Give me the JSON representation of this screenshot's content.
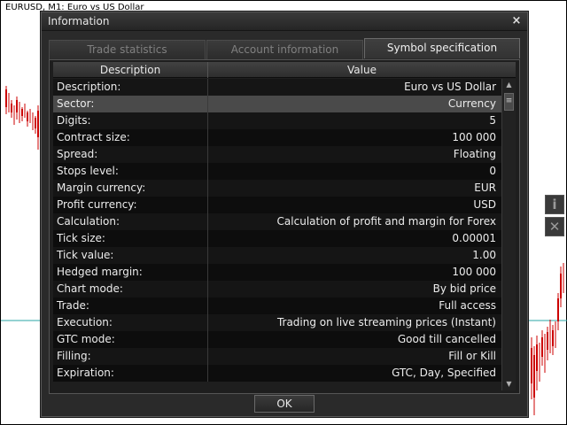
{
  "chart": {
    "title": "EURUSD, M1:  Euro vs US Dollar"
  },
  "side_buttons": {
    "info_glyph": "i",
    "close_glyph": "✕"
  },
  "dialog": {
    "title": "Information",
    "close_glyph": "×",
    "tabs": [
      {
        "label": "Trade statistics",
        "active": false
      },
      {
        "label": "Account information",
        "active": false
      },
      {
        "label": "Symbol specification",
        "active": true
      }
    ],
    "table": {
      "columns": [
        "Description",
        "Value"
      ],
      "rows": [
        {
          "description": "Description:",
          "value": "Euro vs US Dollar"
        },
        {
          "description": "Sector:",
          "value": "Currency",
          "selected": true
        },
        {
          "description": "Digits:",
          "value": "5"
        },
        {
          "description": "Contract size:",
          "value": "100 000"
        },
        {
          "description": "Spread:",
          "value": "Floating"
        },
        {
          "description": "Stops level:",
          "value": "0"
        },
        {
          "description": "Margin currency:",
          "value": "EUR"
        },
        {
          "description": "Profit currency:",
          "value": "USD"
        },
        {
          "description": "Calculation:",
          "value": "Calculation of profit and margin for Forex"
        },
        {
          "description": "Tick size:",
          "value": "0.00001"
        },
        {
          "description": "Tick value:",
          "value": "1.00"
        },
        {
          "description": "Hedged margin:",
          "value": "100 000"
        },
        {
          "description": "Chart mode:",
          "value": "By bid price"
        },
        {
          "description": "Trade:",
          "value": "Full access"
        },
        {
          "description": "Execution:",
          "value": "Trading on live streaming prices (Instant)"
        },
        {
          "description": "GTC mode:",
          "value": "Good till cancelled"
        },
        {
          "description": "Filling:",
          "value": "Fill or Kill"
        },
        {
          "description": "Expiration:",
          "value": "GTC, Day, Specified"
        }
      ]
    },
    "ok_label": "OK"
  }
}
